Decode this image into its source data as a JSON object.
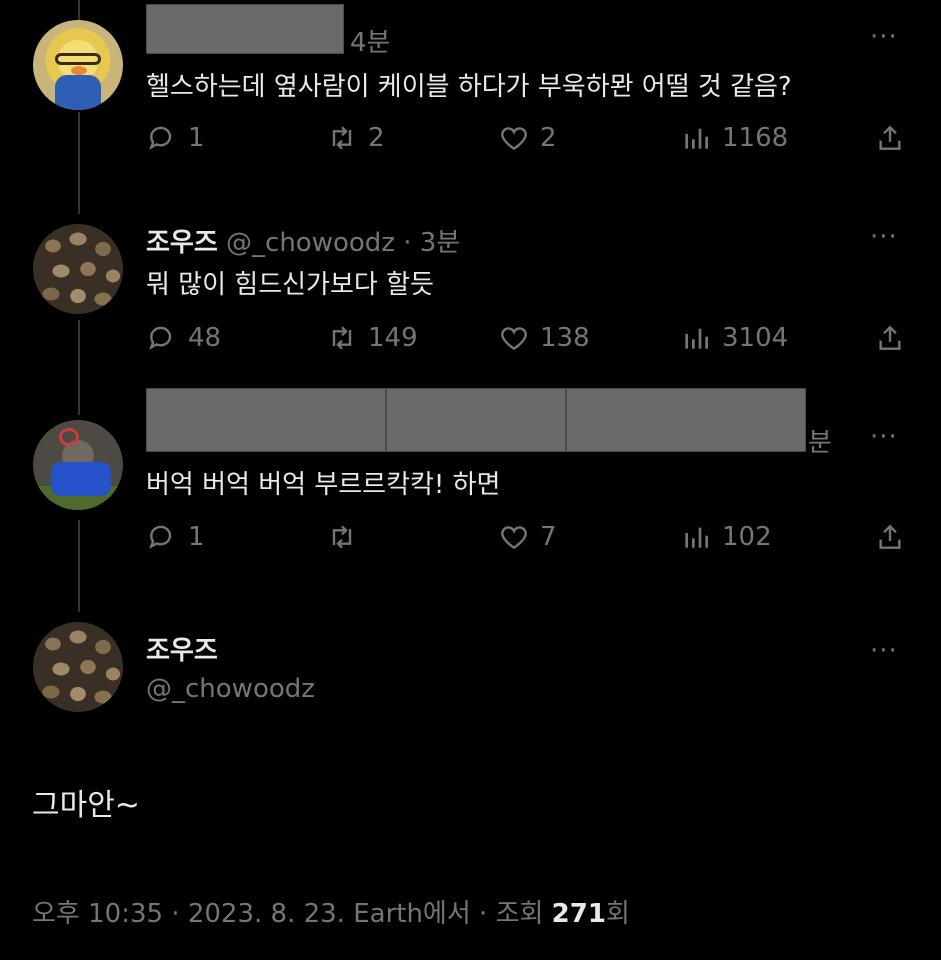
{
  "tweets": [
    {
      "time": "4분",
      "text": "헬스하는데 옆사람이 케이블 하다가 부욱하뫈 어떨 것 같음?",
      "replies": "1",
      "retweets": "2",
      "likes": "2",
      "views": "1168"
    },
    {
      "name": "조우즈",
      "handle": "@_chowoodz",
      "sep": "·",
      "time": "3분",
      "text": "뭐 많이 힘드신가보다 할듯",
      "replies": "48",
      "retweets": "149",
      "likes": "138",
      "views": "3104"
    },
    {
      "time": "분",
      "text": "버억 버억 버억 부르르칵칵! 하면",
      "replies": "1",
      "retweets": "",
      "likes": "7",
      "views": "102"
    }
  ],
  "main": {
    "name": "조우즈",
    "handle": "@_chowoodz",
    "text": "그마안~",
    "footer_prefix": "오후 10:35 · 2023. 8. 23. Earth에서 · 조회 ",
    "views": "271",
    "views_suffix": "회"
  },
  "more_label": "···"
}
